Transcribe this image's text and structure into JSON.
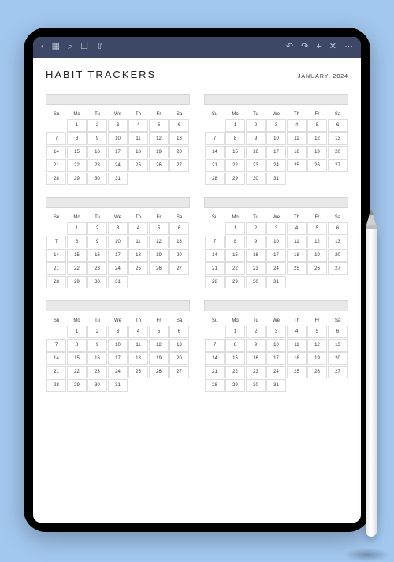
{
  "toolbar": {
    "left_icons": [
      "chevron-left",
      "grid",
      "search",
      "bookmark",
      "share"
    ],
    "right_icons": [
      "undo",
      "redo",
      "plus",
      "close",
      "more"
    ]
  },
  "header": {
    "title": "HABIT TRACKERS",
    "month": "JANUARY, 2024"
  },
  "weekdays": [
    "Su",
    "Mo",
    "Tu",
    "We",
    "Th",
    "Fr",
    "Sa"
  ],
  "calendar": {
    "start_offset": 1,
    "days_in_month": 31
  },
  "tracker_count": 6
}
